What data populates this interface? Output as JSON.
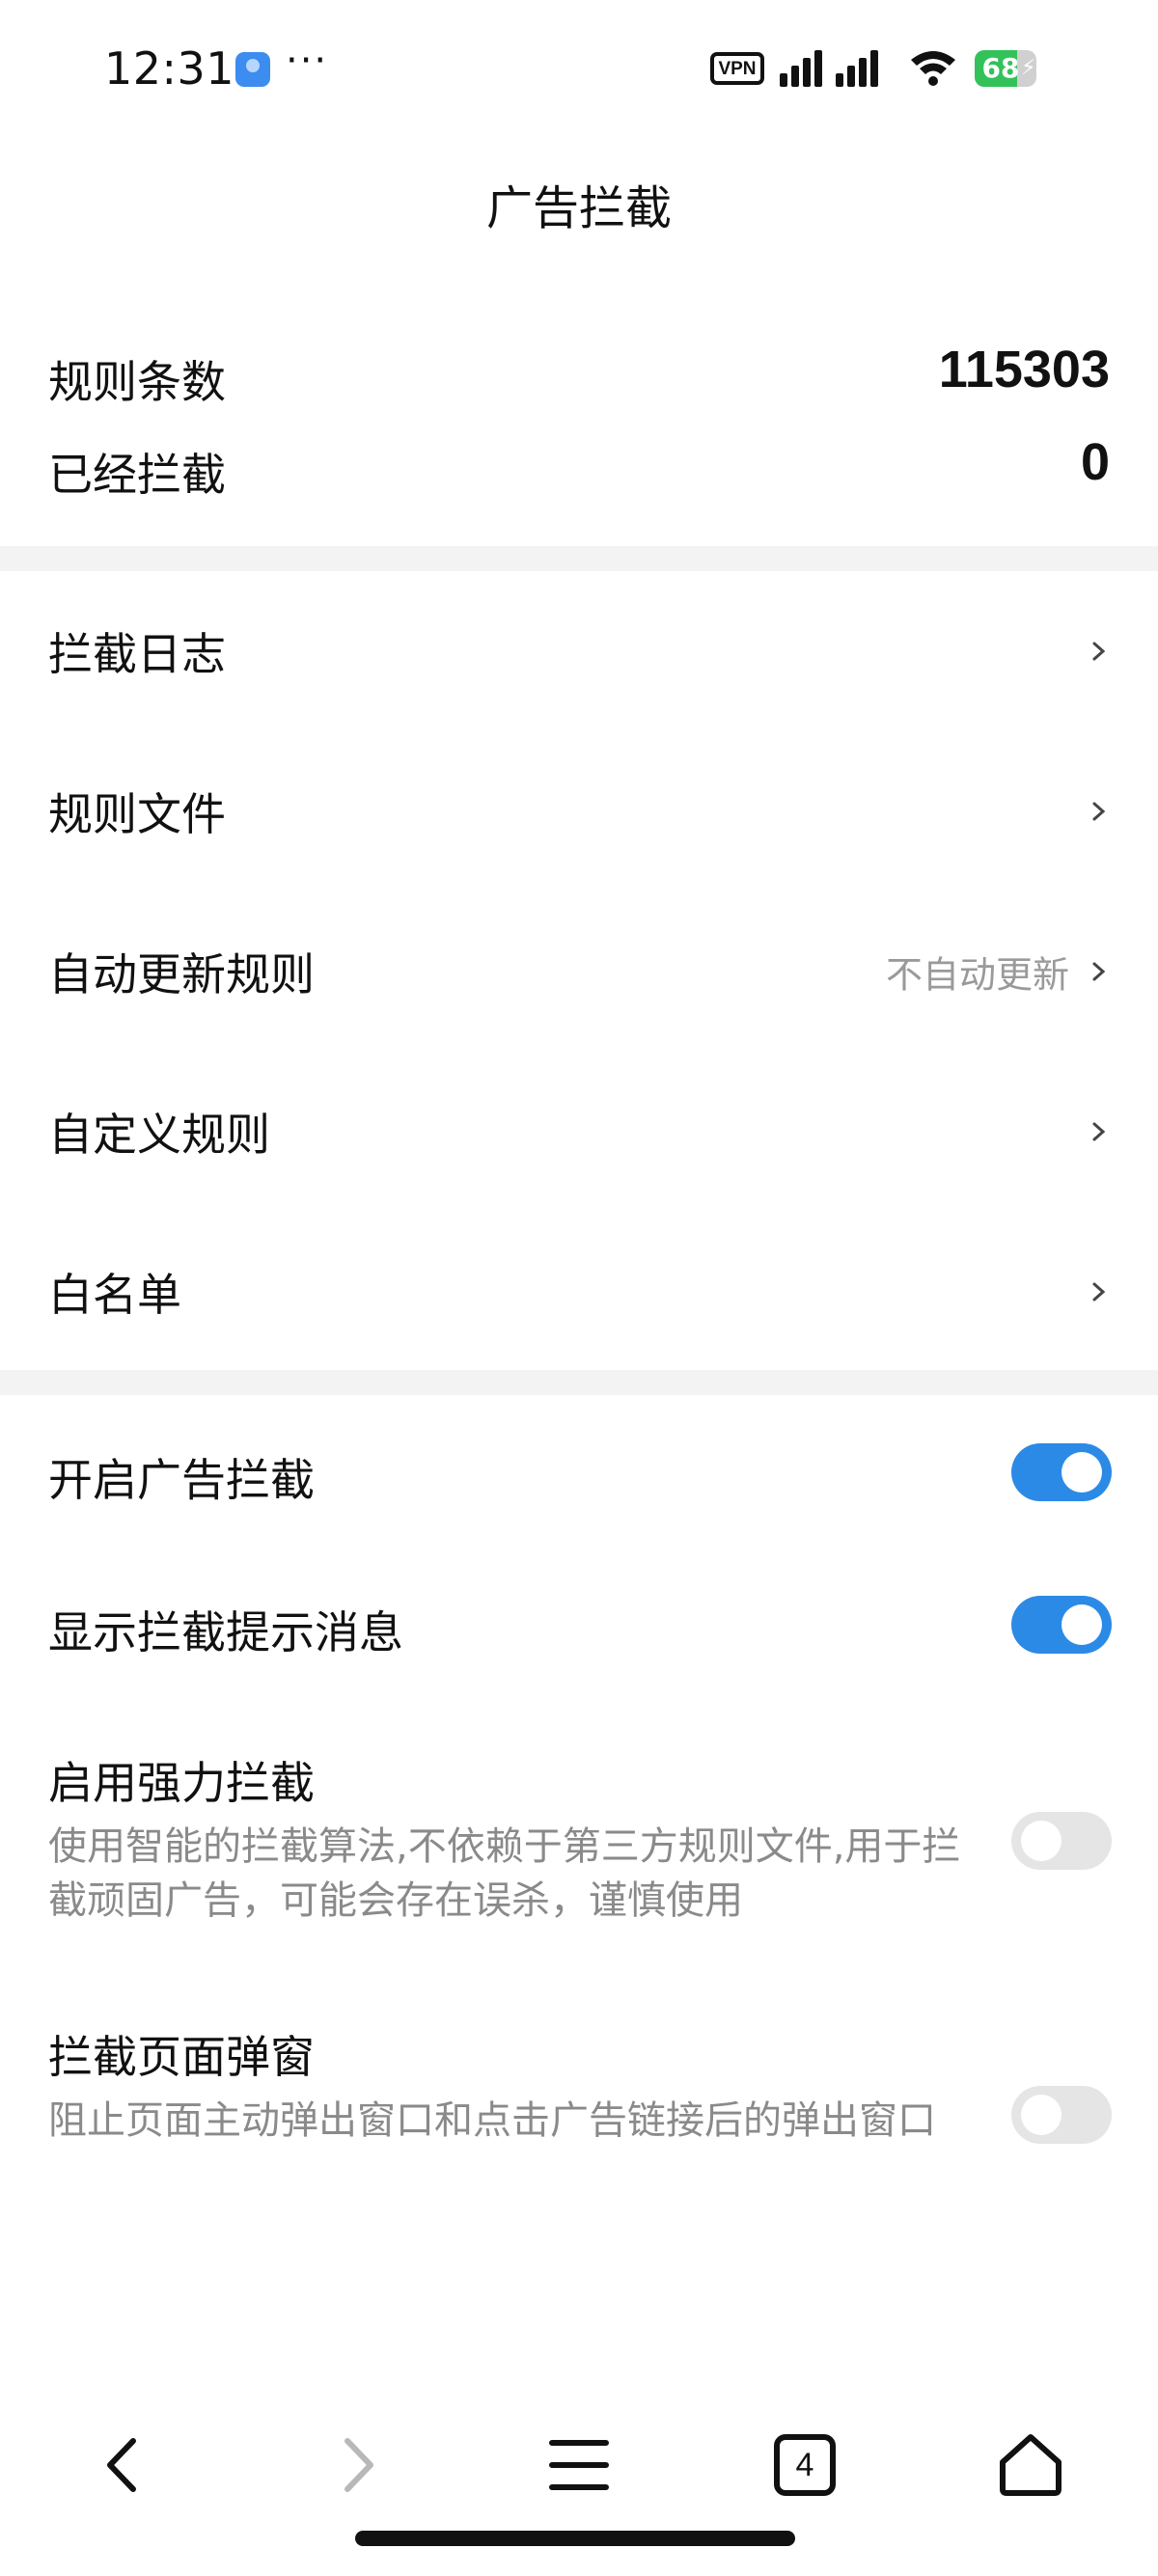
{
  "status_bar": {
    "time": "12:31",
    "more": "···",
    "vpn": "VPN",
    "battery_level": "68",
    "battery_percent": 68
  },
  "header": {
    "title": "广告拦截"
  },
  "stats": [
    {
      "label": "规则条数",
      "value": "115303"
    },
    {
      "label": "已经拦截",
      "value": "0"
    }
  ],
  "menu": [
    {
      "label": "拦截日志",
      "value": ""
    },
    {
      "label": "规则文件",
      "value": ""
    },
    {
      "label": "自动更新规则",
      "value": "不自动更新"
    },
    {
      "label": "自定义规则",
      "value": ""
    },
    {
      "label": "白名单",
      "value": ""
    }
  ],
  "toggles": [
    {
      "title": "开启广告拦截",
      "description": "",
      "on": true
    },
    {
      "title": "显示拦截提示消息",
      "description": "",
      "on": true
    },
    {
      "title": "启用强力拦截",
      "description": "使用智能的拦截算法,不依赖于第三方规则文件,用于拦截顽固广告，可能会存在误杀，谨慎使用",
      "on": false
    },
    {
      "title": "拦截页面弹窗",
      "description": "阻止页面主动弹出窗口和点击广告链接后的弹出窗口",
      "on": false
    }
  ],
  "bottom_nav": {
    "tab_count": "4",
    "icons": [
      "back-icon",
      "forward-icon",
      "menu-icon",
      "tabs-icon",
      "home-icon"
    ]
  },
  "colors": {
    "accent": "#2b8ae6",
    "switch_off": "#e5e5e5",
    "secondary_text": "#8a8a8a",
    "divider": "#f3f3f3",
    "battery": "#33c25a"
  }
}
